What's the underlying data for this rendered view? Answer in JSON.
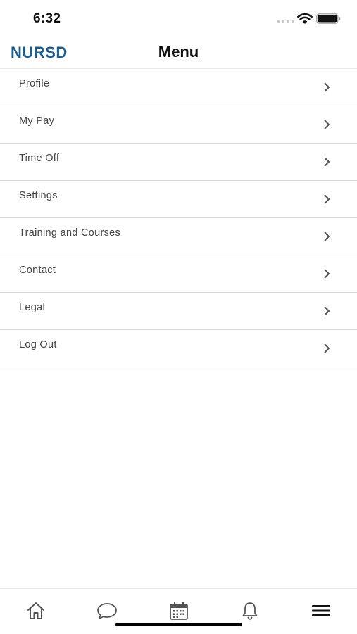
{
  "status_bar": {
    "time": "6:32"
  },
  "header": {
    "brand": "NURSD",
    "title": "Menu"
  },
  "menu": {
    "items": [
      {
        "label": "Profile"
      },
      {
        "label": "My Pay"
      },
      {
        "label": "Time Off"
      },
      {
        "label": "Settings"
      },
      {
        "label": "Training and Courses"
      },
      {
        "label": "Contact"
      },
      {
        "label": "Legal"
      },
      {
        "label": "Log Out"
      }
    ]
  },
  "tab_bar": {
    "tabs": [
      {
        "icon": "home-icon"
      },
      {
        "icon": "chat-bubble-icon"
      },
      {
        "icon": "calendar-icon"
      },
      {
        "icon": "bell-icon"
      },
      {
        "icon": "hamburger-menu-icon",
        "active": true
      }
    ]
  },
  "colors": {
    "brand": "#1d5e8e",
    "divider": "#d6d6d6",
    "label": "#444444"
  }
}
